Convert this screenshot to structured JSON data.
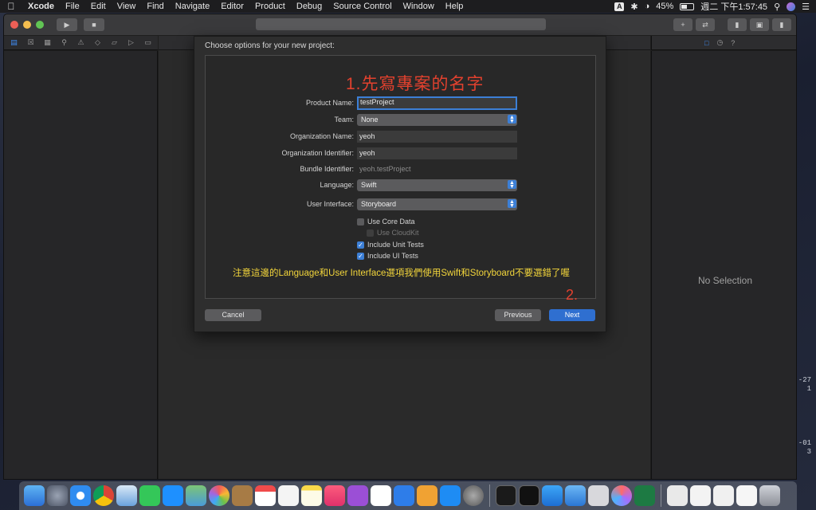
{
  "menubar": {
    "app": "Xcode",
    "menus": [
      "File",
      "Edit",
      "View",
      "Find",
      "Navigate",
      "Editor",
      "Product",
      "Debug",
      "Source Control",
      "Window",
      "Help"
    ],
    "input_source": "A",
    "battery": "45%",
    "clock": "週二 下午1:57:45"
  },
  "inspector": {
    "empty_text": "No Selection"
  },
  "sheet": {
    "title": "Choose options for your new project:",
    "annotation_step1": "1.先寫專案的名字",
    "fields": {
      "product_name_label": "Product Name:",
      "product_name_value": "testProject",
      "team_label": "Team:",
      "team_value": "None",
      "org_name_label": "Organization Name:",
      "org_name_value": "yeoh",
      "org_id_label": "Organization Identifier:",
      "org_id_value": "yeoh",
      "bundle_label": "Bundle Identifier:",
      "bundle_value": "yeoh.testProject",
      "language_label": "Language:",
      "language_value": "Swift",
      "ui_label": "User Interface:",
      "ui_value": "Storyboard"
    },
    "checkboxes": {
      "core_data": {
        "label": "Use Core Data",
        "checked": false
      },
      "cloudkit": {
        "label": "Use CloudKit",
        "checked": false
      },
      "unit_tests": {
        "label": "Include Unit Tests",
        "checked": true
      },
      "ui_tests": {
        "label": "Include UI Tests",
        "checked": true
      }
    },
    "annotation_note": "注意這邊的Language和User Interface選項我們使用Swift和Storyboard不要選錯了喔",
    "annotation_step2": "2.",
    "cancel_label": "Cancel",
    "previous_label": "Previous",
    "next_label": "Next"
  },
  "desktop": {
    "peek_a": "-27",
    "peek_b": "1",
    "peek_c": "-01",
    "peek_d": "3"
  },
  "colors": {
    "accent": "#3c7fd6",
    "annotation_red": "#e2412e",
    "annotation_yellow": "#f2d53b"
  }
}
